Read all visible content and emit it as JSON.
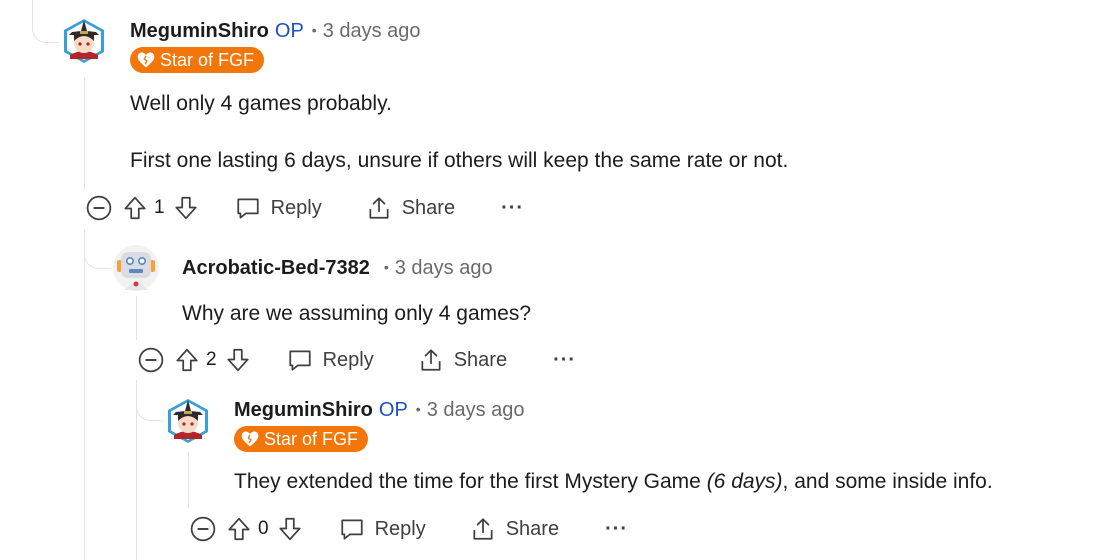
{
  "colors": {
    "op": "#1f4fc1",
    "flair_bg": "#f2760a",
    "meta": "#6a6a6a",
    "thread_line": "#e3e3e3"
  },
  "comments": [
    {
      "username": "MeguminShiro",
      "op_label": "OP",
      "separator": "•",
      "time": "3 days ago",
      "flair": "Star of FGF",
      "flair_icon": "heart-icon",
      "avatar": "witch-avatar",
      "paragraphs": [
        "Well only 4 games probably.",
        "First one lasting 6 days, unsure if others will keep the same rate or not."
      ],
      "score": "1",
      "reply_label": "Reply",
      "share_label": "Share",
      "more_label": "···"
    },
    {
      "username": "Acrobatic-Bed-7382",
      "separator": "•",
      "time": "3 days ago",
      "avatar": "robot-avatar",
      "paragraphs": [
        "Why are we assuming only 4 games?"
      ],
      "score": "2",
      "reply_label": "Reply",
      "share_label": "Share",
      "more_label": "···"
    },
    {
      "username": "MeguminShiro",
      "op_label": "OP",
      "separator": "•",
      "time": "3 days ago",
      "flair": "Star of FGF",
      "flair_icon": "heart-icon",
      "avatar": "witch-avatar",
      "body_parts": {
        "before": "They extended the time for the first Mystery Game ",
        "italic": "(6 days)",
        "after": ", and some inside info."
      },
      "score": "0",
      "reply_label": "Reply",
      "share_label": "Share",
      "more_label": "···"
    }
  ]
}
